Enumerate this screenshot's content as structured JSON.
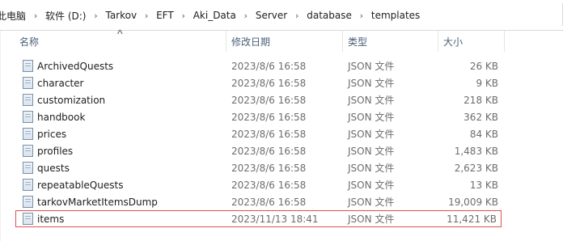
{
  "breadcrumb": [
    "此电脑",
    "软件 (D:)",
    "Tarkov",
    "EFT",
    "Aki_Data",
    "Server",
    "database",
    "templates"
  ],
  "columns": {
    "name": "名称",
    "date": "修改日期",
    "type": "类型",
    "size": "大小"
  },
  "files": [
    {
      "name": "ArchivedQuests",
      "date": "2023/8/6 16:58",
      "type": "JSON 文件",
      "size": "26 KB"
    },
    {
      "name": "character",
      "date": "2023/8/6 16:58",
      "type": "JSON 文件",
      "size": "9 KB"
    },
    {
      "name": "customization",
      "date": "2023/8/6 16:58",
      "type": "JSON 文件",
      "size": "218 KB"
    },
    {
      "name": "handbook",
      "date": "2023/8/6 16:58",
      "type": "JSON 文件",
      "size": "362 KB"
    },
    {
      "name": "prices",
      "date": "2023/8/6 16:58",
      "type": "JSON 文件",
      "size": "84 KB"
    },
    {
      "name": "profiles",
      "date": "2023/8/6 16:58",
      "type": "JSON 文件",
      "size": "1,483 KB"
    },
    {
      "name": "quests",
      "date": "2023/8/6 16:58",
      "type": "JSON 文件",
      "size": "2,623 KB"
    },
    {
      "name": "repeatableQuests",
      "date": "2023/8/6 16:58",
      "type": "JSON 文件",
      "size": "13 KB"
    },
    {
      "name": "tarkovMarketItemsDump",
      "date": "2023/8/6 16:58",
      "type": "JSON 文件",
      "size": "19,009 KB"
    },
    {
      "name": "items",
      "date": "2023/11/13 18:41",
      "type": "JSON 文件",
      "size": "11,421 KB",
      "highlighted": true
    }
  ],
  "colors": {
    "header_text": "#4c607a",
    "highlight_border": "#e25050",
    "detail_text": "#6d6d6d"
  }
}
